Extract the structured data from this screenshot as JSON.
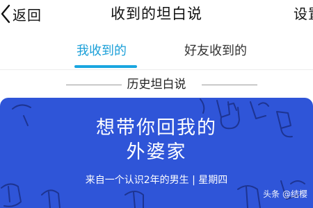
{
  "header": {
    "back_label": "返回",
    "title": "收到的坦白说",
    "settings_label": "设置"
  },
  "tabs": [
    {
      "label": "我收到的",
      "active": true
    },
    {
      "label": "好友收到的",
      "active": false
    }
  ],
  "section": {
    "title": "历史坦白说"
  },
  "card": {
    "message_line1": "想带你回我的",
    "message_line2": "外婆家",
    "meta": "来自一个认识2年的男生 | 星期四",
    "background_color": "#2f55d8"
  },
  "watermark": "头条 @结樱",
  "colors": {
    "accent": "#1a9fd8"
  }
}
